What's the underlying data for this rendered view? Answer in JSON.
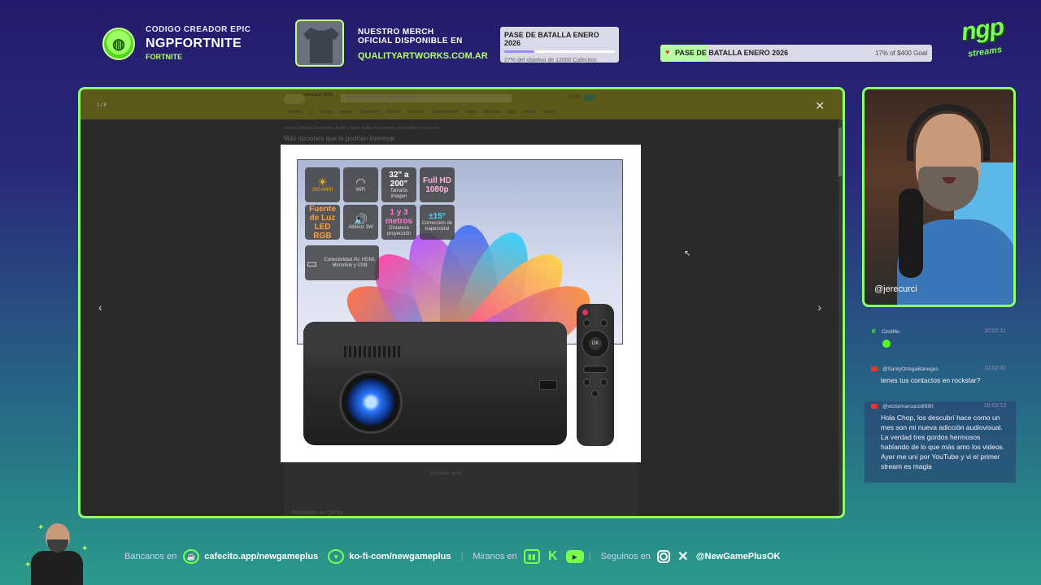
{
  "top": {
    "creator_label": "CODIGO CREADOR EPIC",
    "creator_code": "NGPFORTNITE",
    "creator_game": "FORTNITE",
    "merch_line1": "NUESTRO MERCH",
    "merch_line2": "OFICIAL DISPONIBLE EN",
    "merch_url": "QUALITYARTWORKS.COM.AR",
    "pass_small": {
      "title": "PASE DE BATALLA ENERO 2026",
      "progress": 0.27,
      "subtitle": "27% del objetivo de 12000 Cafecitos"
    },
    "pass_wide": {
      "title": "PASE DE BATALLA ENERO 2026",
      "progress": 0.17,
      "goal": "17% of $400 Goal"
    },
    "brand_big": "ngp",
    "brand_small": "streams"
  },
  "viewer": {
    "page_count": "1 / 8",
    "close": "✕",
    "prev": "‹",
    "next": "›",
    "site": {
      "logo_text": "mercado libre",
      "search_placeholder": "Buscar productos, marcas y más...",
      "price": "8.990",
      "nav": "Ingresá tu código postal   Categorías   Ofertas   Cupones   Supermercado   Moda   Mercado Play   Vender   Ayuda",
      "breadcrumb": "Volver al listado   Electrónica, Audio y Video   Audio   Proyectores y Pantallas   Proyectores",
      "more_options": "Más opciones que te podrían interesar",
      "below_note": "Devolución gratis",
      "below_title": "Productos en Oferta"
    },
    "features": [
      {
        "icon": "sun-icon",
        "glyph": "☀",
        "text": "200 ANSI"
      },
      {
        "icon": "wifi-icon",
        "glyph": "◠",
        "text": "WiFi"
      },
      {
        "icon": "size-icon",
        "glyph": "",
        "big": "32\" a 200\"",
        "text": "Tamaño imagen"
      },
      {
        "icon": "hd-icon",
        "glyph": "",
        "big": "Full HD 1080p",
        "text": ""
      },
      {
        "icon": "led-icon",
        "glyph": "",
        "big": "Fuente de Luz LED RGB",
        "text": ""
      },
      {
        "icon": "speaker-icon",
        "glyph": "🔊",
        "text": "Altavoz 3W"
      },
      {
        "icon": "distance-icon",
        "glyph": "",
        "big": "1 y 3 metros",
        "text": "Distancia proyección"
      },
      {
        "icon": "keystone-icon",
        "glyph": "",
        "big": "±15°",
        "text": "Corrección de trapezoidal"
      },
      {
        "icon": "ports-icon",
        "glyph": "▭",
        "text": "Conectividad AV, HDMI, Mirrorlink y USB"
      }
    ],
    "remote_ok": "OK",
    "petal_colors": [
      "#ff6a3d",
      "#ff3da0",
      "#b34dff",
      "#3d6dff",
      "#2fd0ff",
      "#ffd23d",
      "#ff8c2f"
    ]
  },
  "cam": {
    "handle": "@jerecurci"
  },
  "chat": {
    "messages": [
      {
        "platform": "kick",
        "user": "Ciro96c",
        "time": "10:02:11",
        "text": "",
        "emote": true
      },
      {
        "platform": "youtube",
        "user": "@SantyOrtegaBanegas",
        "time": "10:02:40",
        "text": "tenes tus contactos en rockstar?",
        "emote": false
      },
      {
        "platform": "youtube",
        "user": "@victormarcucci6590",
        "time": "10:03:13",
        "text": "Hola Chop, los descubrí hace como un mes son mi nueva adicción audiovisual. La verdad tres gordos hermosos hablando de lo que más amo los videos. Ayer me uní por YouTube y vi el primer stream es magia",
        "emote": false
      }
    ]
  },
  "bottom": {
    "bank_label": "Bancanos en",
    "cafecito_url": "cafecito.app/newgameplus",
    "kofi_url": "ko-fi-com/newgameplus",
    "watch_label": "Miranos en",
    "follow_label": "Seguinos en",
    "social_handle": "@NewGamePlusOK",
    "divider": "|"
  },
  "colors": {
    "accent": "#8cff6a",
    "brand_green": "#7cff4a",
    "youtube_red": "#ff2d2d",
    "kick_green": "#53fc18"
  }
}
